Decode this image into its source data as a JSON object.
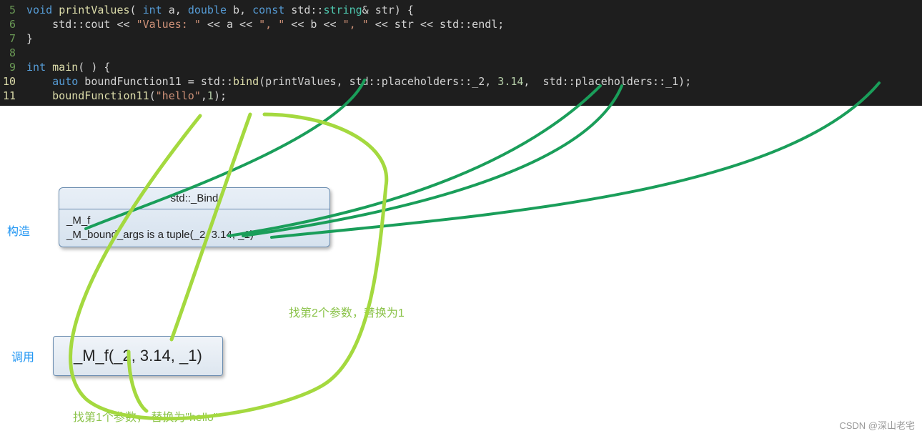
{
  "code": {
    "lines": [
      {
        "num": "5",
        "numClass": "",
        "tokens": [
          {
            "t": " ",
            "c": ""
          },
          {
            "t": "void",
            "c": "kw"
          },
          {
            "t": " ",
            "c": ""
          },
          {
            "t": "printValues",
            "c": "fn"
          },
          {
            "t": "( ",
            "c": "pun"
          },
          {
            "t": "int",
            "c": "kw"
          },
          {
            "t": " a, ",
            "c": "pun"
          },
          {
            "t": "double",
            "c": "kw"
          },
          {
            "t": " b, ",
            "c": "pun"
          },
          {
            "t": "const",
            "c": "kw"
          },
          {
            "t": " std::",
            "c": "pun"
          },
          {
            "t": "string",
            "c": "type"
          },
          {
            "t": "& str) {",
            "c": "pun"
          }
        ]
      },
      {
        "num": "6",
        "numClass": "",
        "tokens": [
          {
            "t": "     std::cout << ",
            "c": "pun"
          },
          {
            "t": "\"Values: \"",
            "c": "str"
          },
          {
            "t": " << a << ",
            "c": "pun"
          },
          {
            "t": "\", \"",
            "c": "str"
          },
          {
            "t": " << b << ",
            "c": "pun"
          },
          {
            "t": "\", \"",
            "c": "str"
          },
          {
            "t": " << str << std::endl;",
            "c": "pun"
          }
        ]
      },
      {
        "num": "7",
        "numClass": "",
        "tokens": [
          {
            "t": " }",
            "c": "pun"
          }
        ]
      },
      {
        "num": "8",
        "numClass": "",
        "tokens": []
      },
      {
        "num": "9",
        "numClass": "",
        "tokens": [
          {
            "t": " ",
            "c": ""
          },
          {
            "t": "int",
            "c": "kw"
          },
          {
            "t": " ",
            "c": ""
          },
          {
            "t": "main",
            "c": "fn"
          },
          {
            "t": "( ) {",
            "c": "pun"
          }
        ]
      },
      {
        "num": "10",
        "numClass": "yellow",
        "tokens": [
          {
            "t": "     ",
            "c": ""
          },
          {
            "t": "auto",
            "c": "kw"
          },
          {
            "t": " boundFunction11 = std::",
            "c": "pun"
          },
          {
            "t": "bind",
            "c": "fn"
          },
          {
            "t": "(printValues, std::placeholders::_2, ",
            "c": "pun"
          },
          {
            "t": "3.14",
            "c": "num"
          },
          {
            "t": ",  std::placeholders::_1);",
            "c": "pun"
          }
        ]
      },
      {
        "num": "11",
        "numClass": "yellow",
        "tokens": [
          {
            "t": "     ",
            "c": ""
          },
          {
            "t": "boundFunction11",
            "c": "fn"
          },
          {
            "t": "(",
            "c": "pun"
          },
          {
            "t": "\"hello\"",
            "c": "str"
          },
          {
            "t": ",",
            "c": "pun"
          },
          {
            "t": "1",
            "c": "num"
          },
          {
            "t": ");",
            "c": "pun"
          }
        ]
      }
    ]
  },
  "labels": {
    "construct": "构造",
    "call": "调用"
  },
  "box": {
    "header": "std::_Bind",
    "line1": "_M_f",
    "line2": "_M_bound_args is a tuple(_2, 3.14, _1)"
  },
  "callBox": "_M_f(_2, 3.14, _1)",
  "annotations": {
    "replace2": "找第2个参数，替换为1",
    "replace1": "找第1个参数， 替换为\"hello\""
  },
  "watermark": "CSDN @深山老宅",
  "curves": {
    "green": [
      "M 510 112 C 470 200, 190 290, 120 320",
      "M 840 120 C 700 260, 450 310, 320 330",
      "M 870 120 C 820 240, 550 300, 340 330",
      "M 1230 116 C 1100 270, 700 300, 380 332"
    ],
    "lime": [
      "M 280 162 C 130 350, 60 500, 120 558 C 180 610, 380 580, 450 540 C 520 500, 530 360, 540 260 C 550 200, 460 160, 370 160",
      "M 350 160 C 300 300, 260 420, 240 475",
      "M 180 492 C 180 540, 195 568, 205 575"
    ]
  }
}
